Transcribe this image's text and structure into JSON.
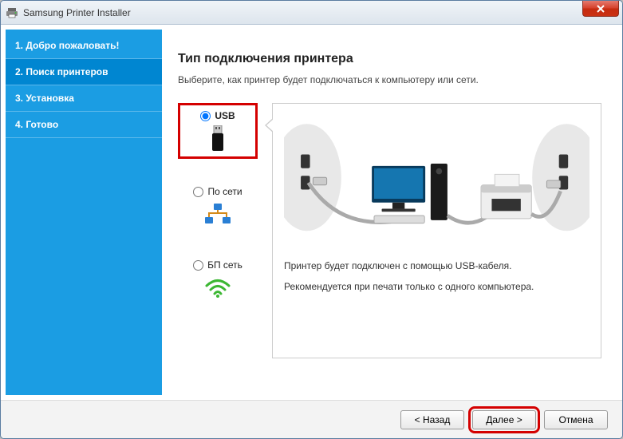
{
  "window": {
    "title": "Samsung Printer Installer"
  },
  "sidebar": {
    "steps": [
      "1. Добро пожаловать!",
      "2. Поиск принтеров",
      "3. Установка",
      "4. Готово"
    ],
    "active_index": 1
  },
  "main": {
    "heading": "Тип подключения принтера",
    "subtitle": "Выберите, как принтер будет подключаться к компьютеру или сети.",
    "options": {
      "usb": "USB",
      "network": "По сети",
      "wireless": "БП сеть"
    },
    "description": {
      "line1": "Принтер будет подключен с помощью USB-кабеля.",
      "line2": "Рекомендуется при печати только с одного компьютера."
    }
  },
  "footer": {
    "back": "< Назад",
    "next": "Далее >",
    "cancel": "Отмена"
  }
}
